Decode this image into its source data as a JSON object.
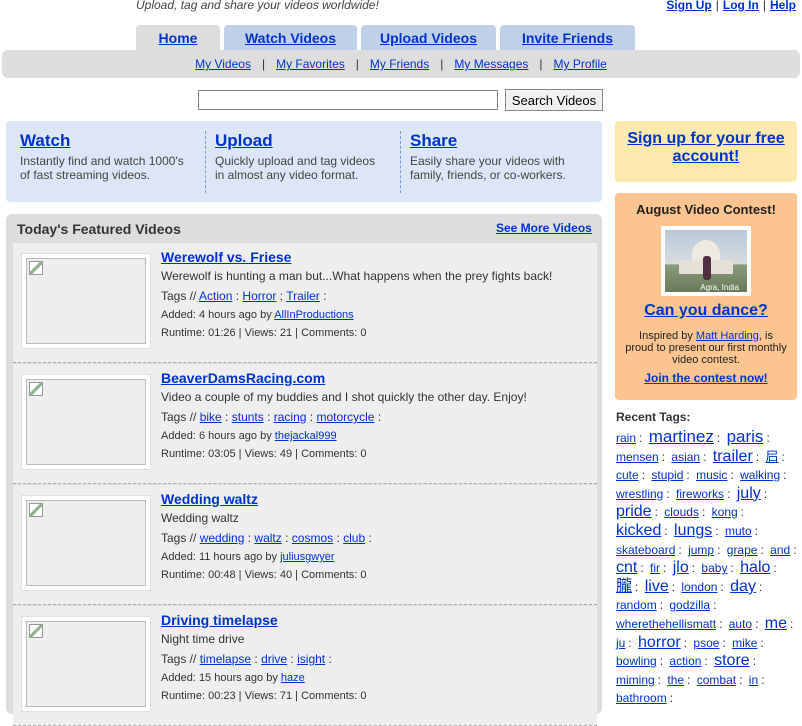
{
  "header": {
    "tagline": "Upload, tag and share your videos worldwide!",
    "links": [
      "Sign Up",
      "Log In",
      "Help"
    ],
    "separator": "|"
  },
  "tabs": [
    {
      "label": "Home",
      "active": true
    },
    {
      "label": "Watch Videos",
      "active": false
    },
    {
      "label": "Upload Videos",
      "active": false
    },
    {
      "label": "Invite Friends",
      "active": false
    }
  ],
  "subnav": [
    "My Videos",
    "My Favorites",
    "My Friends",
    "My Messages",
    "My Profile"
  ],
  "search": {
    "value": "",
    "button": "Search Videos"
  },
  "intro": [
    {
      "title": "Watch",
      "desc1": "Instantly find and watch 1000's",
      "desc2": "of fast streaming videos."
    },
    {
      "title": "Upload",
      "desc1": "Quickly upload and tag videos",
      "desc2": "in almost any video format."
    },
    {
      "title": "Share",
      "desc1": "Easily share your videos with",
      "desc2": "family, friends, or co-workers."
    }
  ],
  "featured": {
    "title": "Today's Featured Videos",
    "see_more": "See More Videos",
    "tags_prefix": "Tags //",
    "added_prefix": "Added:",
    "by": "by",
    "runtime_label": "Runtime:",
    "views_label": "Views:",
    "comments_label": "Comments:",
    "videos": [
      {
        "title": "Werewolf vs. Friese",
        "desc": "Werewolf is hunting a man but...What happens when the prey fights back!",
        "tags": [
          "Action",
          "Horror",
          "Trailer"
        ],
        "added": "4 hours ago",
        "user": "AllInProductions",
        "runtime": "01:26",
        "views": "21",
        "comments": "0"
      },
      {
        "title": "BeaverDamsRacing.com",
        "desc": "Video a couple of my buddies and I shot quickly the other day. Enjoy!",
        "tags": [
          "bike",
          "stunts",
          "racing",
          "motorcycle"
        ],
        "added": "6 hours ago",
        "user": "thejackal999",
        "runtime": "03:05",
        "views": "49",
        "comments": "0"
      },
      {
        "title": "Wedding waltz",
        "desc": "Wedding waltz",
        "tags": [
          "wedding",
          "waltz",
          "cosmos",
          "club"
        ],
        "added": "11 hours ago",
        "user": "juliusgwyer",
        "runtime": "00:48",
        "views": "40",
        "comments": "0"
      },
      {
        "title": "Driving timelapse",
        "desc": "Night time drive",
        "tags": [
          "timelapse",
          "drive",
          "isight"
        ],
        "added": "15 hours ago",
        "user": "haze",
        "runtime": "00:23",
        "views": "71",
        "comments": "0"
      }
    ]
  },
  "sidebar": {
    "signup": "Sign up for your free account!",
    "contest": {
      "title": "August Video Contest!",
      "image_caption": "Agra, India",
      "link": "Can you dance?",
      "text_pre": "Inspired by",
      "author": "Matt Harding",
      "text_post": ", is proud to present our first monthly video contest.",
      "join": "Join the contest now!"
    },
    "recent_tags_title": "Recent Tags:",
    "tags": [
      {
        "t": "rain",
        "s": 1
      },
      {
        "t": "martinez",
        "s": 4
      },
      {
        "t": "paris",
        "s": 4
      },
      {
        "t": "mensen",
        "s": 1
      },
      {
        "t": "asian",
        "s": 1
      },
      {
        "t": "trailer",
        "s": 3
      },
      {
        "t": "𡰪",
        "s": 2
      },
      {
        "t": "cute",
        "s": 1
      },
      {
        "t": "stupid",
        "s": 1
      },
      {
        "t": "music",
        "s": 1
      },
      {
        "t": "walking",
        "s": 1
      },
      {
        "t": "wrestling",
        "s": 1
      },
      {
        "t": "fireworks",
        "s": 1
      },
      {
        "t": "july",
        "s": 3
      },
      {
        "t": "pride",
        "s": 3
      },
      {
        "t": "clouds",
        "s": 1
      },
      {
        "t": "kong",
        "s": 1
      },
      {
        "t": "kicked",
        "s": 3
      },
      {
        "t": "lungs",
        "s": 3
      },
      {
        "t": "muto",
        "s": 1
      },
      {
        "t": "skateboard",
        "s": 1
      },
      {
        "t": "jump",
        "s": 1
      },
      {
        "t": "grape",
        "s": 1
      },
      {
        "t": "and",
        "s": 1
      },
      {
        "t": "cnt",
        "s": 3
      },
      {
        "t": "fir",
        "s": 1
      },
      {
        "t": "jlo",
        "s": 3
      },
      {
        "t": "baby",
        "s": 1
      },
      {
        "t": "halo",
        "s": 3
      },
      {
        "t": "朧",
        "s": 3
      },
      {
        "t": "live",
        "s": 3
      },
      {
        "t": "london",
        "s": 1
      },
      {
        "t": "day",
        "s": 3
      },
      {
        "t": "random",
        "s": 1
      },
      {
        "t": "godzilla",
        "s": 1
      },
      {
        "t": "wherethehellismatt",
        "s": 1
      },
      {
        "t": "auto",
        "s": 1
      },
      {
        "t": "me",
        "s": 3
      },
      {
        "t": "ju",
        "s": 1
      },
      {
        "t": "horror",
        "s": 3
      },
      {
        "t": "psoe",
        "s": 1
      },
      {
        "t": "mike",
        "s": 1
      },
      {
        "t": "bowling",
        "s": 1
      },
      {
        "t": "action",
        "s": 1
      },
      {
        "t": "store",
        "s": 3
      },
      {
        "t": "miming",
        "s": 1
      },
      {
        "t": "the",
        "s": 1
      },
      {
        "t": "combat",
        "s": 1
      },
      {
        "t": "in",
        "s": 1
      },
      {
        "t": "bathroom",
        "s": 1
      }
    ]
  }
}
